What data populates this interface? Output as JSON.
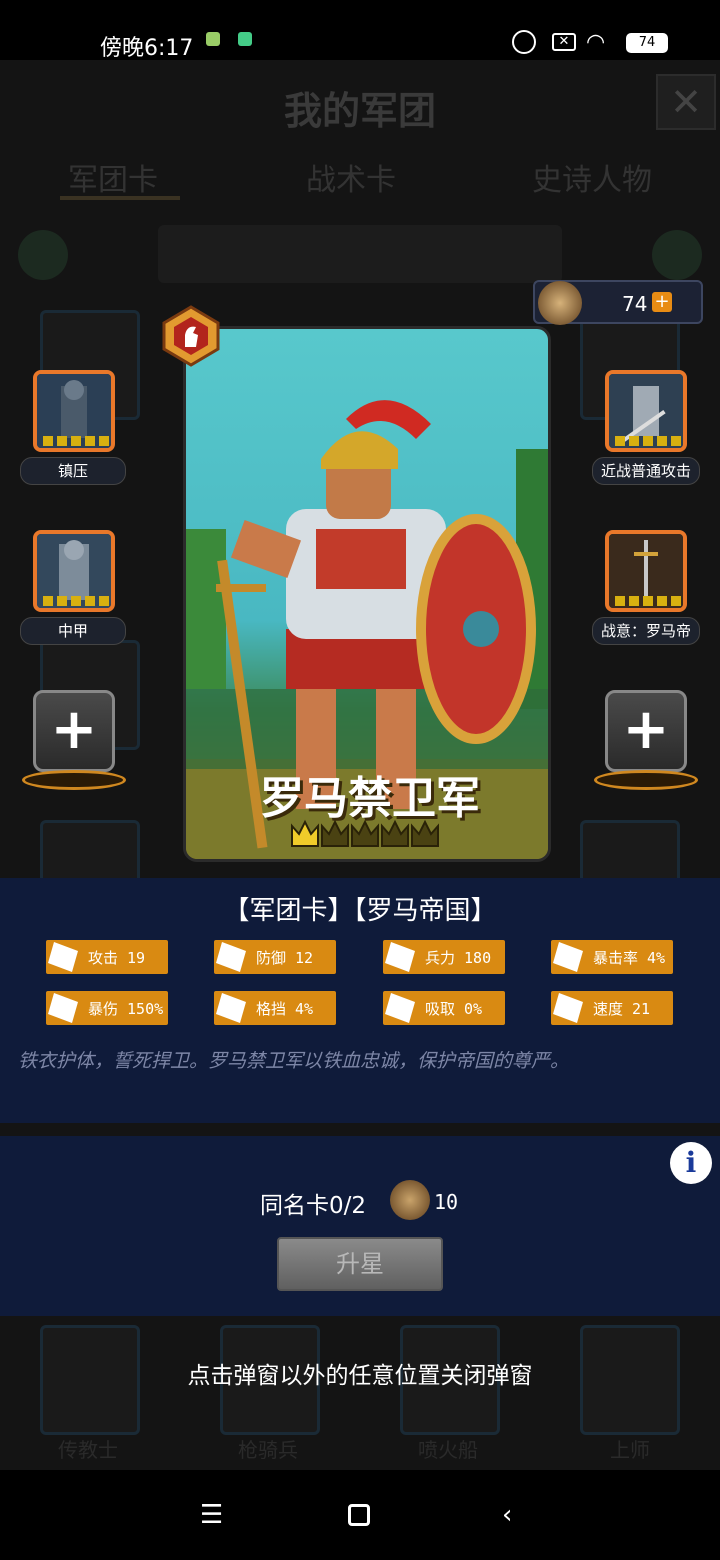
{
  "status_bar": {
    "time": "傍晚6:17",
    "battery": "74"
  },
  "background_page": {
    "title": "我的军团",
    "tabs": [
      "军团卡",
      "战术卡",
      "史诗人物"
    ],
    "partial_labels": [
      "传教士",
      "枪骑兵",
      "喷火船",
      "上师"
    ]
  },
  "currency": {
    "value": "74",
    "plus": "+"
  },
  "card": {
    "name": "罗马禁卫军",
    "stars_filled": 1,
    "stars_total": 5
  },
  "left_slots": [
    {
      "label": "镇压"
    },
    {
      "label": "中甲"
    }
  ],
  "right_slots": [
    {
      "label": "近战普通攻击"
    },
    {
      "label": "战意：罗马帝"
    }
  ],
  "add_button": "+",
  "info": {
    "type_line": "【军团卡】【罗马帝国】",
    "stats": [
      {
        "label": "攻击 19",
        "icon": "sword-icon"
      },
      {
        "label": "防御 12",
        "icon": "shield-icon"
      },
      {
        "label": "兵力 180",
        "icon": "heart-icon"
      },
      {
        "label": "暴击率 4%",
        "icon": "crosshair-icon"
      },
      {
        "label": "暴伤 150%",
        "icon": "burst-icon"
      },
      {
        "label": "格挡 4%",
        "icon": "block-icon"
      },
      {
        "label": "吸取 0%",
        "icon": "drain-icon"
      },
      {
        "label": "速度 21",
        "icon": "boot-icon"
      }
    ],
    "flavor": "铁衣护体，誓死捍卫。罗马禁卫军以铁血忠诚，保护帝国的尊严。"
  },
  "upgrade": {
    "duplicate_label": "同名卡0/2",
    "cost": "10",
    "star_button": "升星"
  },
  "close_hint": "点击弹窗以外的任意位置关闭弹窗",
  "colors": {
    "panel": "#0f1b3a",
    "accent": "#d98a12",
    "slot_border": "#e9782a"
  }
}
